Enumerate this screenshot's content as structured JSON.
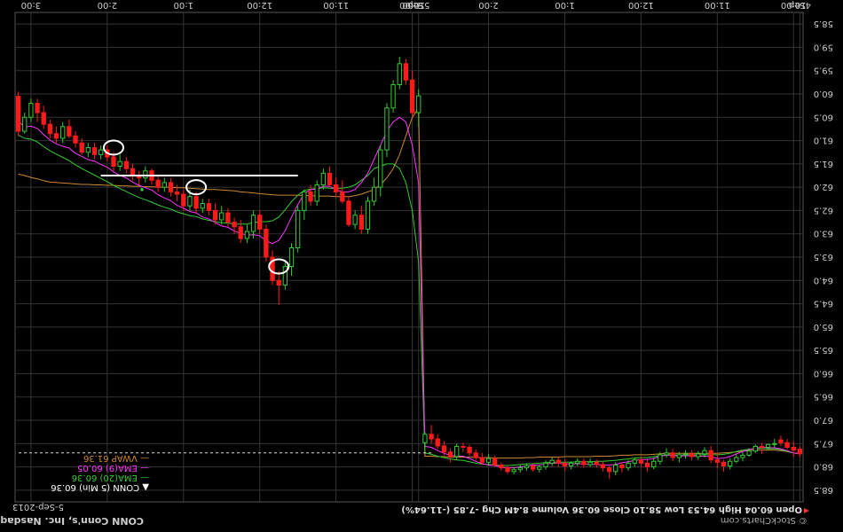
{
  "chart_data": {
    "type": "candlestick",
    "title": "CONN Conn's, Inc. Nasdaq GS",
    "date": "5-Sep-2013",
    "watermark": "© StockCharts.com",
    "summary": "Open 60.04  High 64.53  Low 58.10  Close 60.36  Volume 8.4M  Chg -7.85 (-11.64%)",
    "x_tick_labels": [
      "4Sep",
      "10:00",
      "11:00",
      "12:00",
      "1:00",
      "2:00",
      "3:00",
      "5Sep",
      "10:00",
      "11:00",
      "12:00",
      "1:00",
      "2:00",
      "3:00"
    ],
    "y_tick_labels": [
      "58.5",
      "59.0",
      "59.5",
      "60.0",
      "60.5",
      "61.0",
      "61.5",
      "62.0",
      "62.5",
      "63.0",
      "63.5",
      "64.0",
      "64.5",
      "65.0",
      "65.5",
      "66.0",
      "66.5",
      "67.0",
      "67.5",
      "68.0",
      "68.5"
    ],
    "ylim": [
      58.25,
      68.75
    ],
    "legend": [
      {
        "label": "CONN (5 Min) 60.36",
        "color": "#ffffff",
        "marker": "▲"
      },
      {
        "label": "EMA(20) 60.36",
        "color": "#33cc33"
      },
      {
        "label": "EMA(9) 60.05",
        "color": "#ff33ff"
      },
      {
        "label": "VWAP 61.36",
        "color": "#cc8833"
      }
    ],
    "colors": {
      "up": "#33cc33",
      "down": "#ff1a1a",
      "ema20": "#33cc33",
      "ema9": "#ff33ff",
      "vwap": "#cc8833",
      "grid": "#333333",
      "hline": "#ffffff",
      "circle": "#ffffff",
      "dash": "#dddddd"
    },
    "candles": [
      [
        67.72,
        67.62,
        67.8,
        67.55
      ],
      [
        67.64,
        67.58,
        67.78,
        67.45
      ],
      [
        67.58,
        67.48,
        67.62,
        67.4
      ],
      [
        67.48,
        67.42,
        67.55,
        67.33
      ],
      [
        67.5,
        67.52,
        67.58,
        67.4
      ],
      [
        67.52,
        67.58,
        67.65,
        67.5
      ],
      [
        67.58,
        67.56,
        67.72,
        67.48
      ],
      [
        67.56,
        67.66,
        67.7,
        67.52
      ],
      [
        67.66,
        67.75,
        67.78,
        67.6
      ],
      [
        67.75,
        67.8,
        67.88,
        67.68
      ],
      [
        67.8,
        67.88,
        67.92,
        67.72
      ],
      [
        67.88,
        67.98,
        68.05,
        67.82
      ],
      [
        67.98,
        67.9,
        68.1,
        67.85
      ],
      [
        67.9,
        67.85,
        68.02,
        67.7
      ],
      [
        67.85,
        67.65,
        67.92,
        67.55
      ],
      [
        67.65,
        67.72,
        67.8,
        67.58
      ],
      [
        67.72,
        67.78,
        67.85,
        67.66
      ],
      [
        67.78,
        67.72,
        67.86,
        67.64
      ],
      [
        67.72,
        67.74,
        67.82,
        67.64
      ],
      [
        67.74,
        67.8,
        67.9,
        67.68
      ],
      [
        67.8,
        67.7,
        67.88,
        67.62
      ],
      [
        67.7,
        67.74,
        67.8,
        67.6
      ],
      [
        67.74,
        67.88,
        67.95,
        67.68
      ],
      [
        67.88,
        68.0,
        68.05,
        67.8
      ],
      [
        68.0,
        67.92,
        68.1,
        67.85
      ],
      [
        67.92,
        67.85,
        68.0,
        67.78
      ],
      [
        67.85,
        67.92,
        68.0,
        67.8
      ],
      [
        67.92,
        68.02,
        68.08,
        67.86
      ],
      [
        68.02,
        67.96,
        68.12,
        67.9
      ],
      [
        67.96,
        68.1,
        68.18,
        67.9
      ],
      [
        68.1,
        68.02,
        68.25,
        67.98
      ],
      [
        68.02,
        67.95,
        68.1,
        67.88
      ],
      [
        67.95,
        67.9,
        68.02,
        67.84
      ],
      [
        67.9,
        67.95,
        68.0,
        67.82
      ],
      [
        67.95,
        67.88,
        68.02,
        67.82
      ],
      [
        67.88,
        67.92,
        67.98,
        67.82
      ],
      [
        67.92,
        67.98,
        68.05,
        67.88
      ],
      [
        67.98,
        67.92,
        68.08,
        67.84
      ],
      [
        67.92,
        67.86,
        68.0,
        67.8
      ],
      [
        67.86,
        67.92,
        67.98,
        67.8
      ],
      [
        67.92,
        68.0,
        68.06,
        67.86
      ],
      [
        68.0,
        68.05,
        68.12,
        67.95
      ],
      [
        68.05,
        67.98,
        68.1,
        67.92
      ],
      [
        67.98,
        68.02,
        68.08,
        67.92
      ],
      [
        68.02,
        68.06,
        68.12,
        67.96
      ],
      [
        68.06,
        68.1,
        68.16,
        68.0
      ],
      [
        68.1,
        68.02,
        68.15,
        67.96
      ],
      [
        68.02,
        67.96,
        68.08,
        67.9
      ],
      [
        67.96,
        67.82,
        68.0,
        67.76
      ],
      [
        67.82,
        67.9,
        67.96,
        67.72
      ],
      [
        67.9,
        67.8,
        67.95,
        67.7
      ],
      [
        67.8,
        67.7,
        67.86,
        67.62
      ],
      [
        67.7,
        67.58,
        67.76,
        67.52
      ],
      [
        67.58,
        67.56,
        67.68,
        67.48
      ],
      [
        67.56,
        67.78,
        67.85,
        67.5
      ],
      [
        67.78,
        67.68,
        67.9,
        67.6
      ],
      [
        67.68,
        67.55,
        67.75,
        67.45
      ],
      [
        67.55,
        67.4,
        67.62,
        67.3
      ],
      [
        67.4,
        67.3,
        67.5,
        67.1
      ],
      [
        67.3,
        67.48,
        67.58,
        67.25
      ],
      [
        60.04,
        60.4,
        60.7,
        59.9
      ],
      [
        60.4,
        59.7,
        60.5,
        59.5
      ],
      [
        59.7,
        59.35,
        59.8,
        59.25
      ],
      [
        59.35,
        59.8,
        59.9,
        59.2
      ],
      [
        59.8,
        60.3,
        60.4,
        59.7
      ],
      [
        60.3,
        61.2,
        61.35,
        60.2
      ],
      [
        61.2,
        62.0,
        62.2,
        61.1
      ],
      [
        62.0,
        62.3,
        62.4,
        61.8
      ],
      [
        62.3,
        62.9,
        63.0,
        62.2
      ],
      [
        62.9,
        62.6,
        63.0,
        62.4
      ],
      [
        62.6,
        62.8,
        62.9,
        62.5
      ],
      [
        62.8,
        62.3,
        62.85,
        62.2
      ],
      [
        62.3,
        62.1,
        62.35,
        61.85
      ],
      [
        62.1,
        61.95,
        62.2,
        61.8
      ],
      [
        61.95,
        61.7,
        62.0,
        61.55
      ],
      [
        61.7,
        61.95,
        62.05,
        61.6
      ],
      [
        61.95,
        62.3,
        62.4,
        61.85
      ],
      [
        62.3,
        62.1,
        62.4,
        61.95
      ],
      [
        62.1,
        62.5,
        62.7,
        62.05
      ],
      [
        62.5,
        63.3,
        63.4,
        62.4
      ],
      [
        63.3,
        63.7,
        63.9,
        63.2
      ],
      [
        63.7,
        64.1,
        64.2,
        63.6
      ],
      [
        64.1,
        64.0,
        64.53,
        63.8
      ],
      [
        64.0,
        63.5,
        64.1,
        63.35
      ],
      [
        63.5,
        62.9,
        63.6,
        62.8
      ],
      [
        62.9,
        62.6,
        63.0,
        62.5
      ],
      [
        62.6,
        62.95,
        63.1,
        62.5
      ],
      [
        62.95,
        63.1,
        63.2,
        62.8
      ],
      [
        63.1,
        62.85,
        63.2,
        62.7
      ],
      [
        62.85,
        62.75,
        63.0,
        62.65
      ],
      [
        62.75,
        62.55,
        62.85,
        62.45
      ],
      [
        62.55,
        62.7,
        62.8,
        62.4
      ],
      [
        62.7,
        62.5,
        62.8,
        62.35
      ],
      [
        62.5,
        62.35,
        62.6,
        62.25
      ],
      [
        62.35,
        62.45,
        62.55,
        62.25
      ],
      [
        62.45,
        62.2,
        62.55,
        62.1
      ],
      [
        62.2,
        62.4,
        62.5,
        62.05
      ],
      [
        62.4,
        62.15,
        62.5,
        62.05
      ],
      [
        62.15,
        62.1,
        62.3,
        61.95
      ],
      [
        62.1,
        61.9,
        62.2,
        61.8
      ],
      [
        61.9,
        62.0,
        62.1,
        61.8
      ],
      [
        62.0,
        61.85,
        62.1,
        61.75
      ],
      [
        61.85,
        61.65,
        61.95,
        61.6
      ],
      [
        61.65,
        61.8,
        61.9,
        61.55
      ],
      [
        61.8,
        61.75,
        61.95,
        61.65
      ],
      [
        61.75,
        61.6,
        61.85,
        61.5
      ],
      [
        61.6,
        61.45,
        61.7,
        61.35
      ],
      [
        61.45,
        61.55,
        61.65,
        61.3
      ],
      [
        61.55,
        61.35,
        61.65,
        61.25
      ],
      [
        61.35,
        61.2,
        61.45,
        61.1
      ],
      [
        61.2,
        61.3,
        61.4,
        61.1
      ],
      [
        61.3,
        61.15,
        61.4,
        61.05
      ],
      [
        61.15,
        61.25,
        61.35,
        61.05
      ],
      [
        61.25,
        61.05,
        61.3,
        60.95
      ],
      [
        61.05,
        60.9,
        61.15,
        60.8
      ],
      [
        60.9,
        60.7,
        60.95,
        60.55
      ],
      [
        60.7,
        60.95,
        61.05,
        60.6
      ],
      [
        60.95,
        60.85,
        61.05,
        60.7
      ],
      [
        60.85,
        60.65,
        60.95,
        60.55
      ],
      [
        60.65,
        60.4,
        60.75,
        60.25
      ],
      [
        60.4,
        60.2,
        60.6,
        60.1
      ],
      [
        60.2,
        60.5,
        60.6,
        60.1
      ],
      [
        60.5,
        60.8,
        60.85,
        60.4
      ],
      [
        60.8,
        60.05,
        60.9,
        59.95
      ]
    ],
    "ema20": [
      67.72,
      67.7,
      67.67,
      67.63,
      67.61,
      67.61,
      67.6,
      67.61,
      67.62,
      67.64,
      67.67,
      67.71,
      67.73,
      67.74,
      67.74,
      67.74,
      67.74,
      67.74,
      67.74,
      67.75,
      67.74,
      67.74,
      67.76,
      67.78,
      67.8,
      67.8,
      67.81,
      67.83,
      67.84,
      67.86,
      67.87,
      67.88,
      67.88,
      67.89,
      67.89,
      67.89,
      67.9,
      67.9,
      67.9,
      67.9,
      67.91,
      67.92,
      67.93,
      67.94,
      67.95,
      67.96,
      67.97,
      67.97,
      67.96,
      67.95,
      67.94,
      67.92,
      67.89,
      67.86,
      67.85,
      67.83,
      67.8,
      67.77,
      67.73,
      67.7,
      63.6,
      62.5,
      61.9,
      61.6,
      61.5,
      61.5,
      61.55,
      61.6,
      61.75,
      61.85,
      61.95,
      62.0,
      62.02,
      62.03,
      62.02,
      62.01,
      62.03,
      62.04,
      62.07,
      62.17,
      62.31,
      62.48,
      62.64,
      62.72,
      62.74,
      62.74,
      62.76,
      62.79,
      62.79,
      62.79,
      62.77,
      62.76,
      62.74,
      62.71,
      62.68,
      62.63,
      62.61,
      62.57,
      62.53,
      62.47,
      62.43,
      62.38,
      62.32,
      62.27,
      62.22,
      62.16,
      62.09,
      62.03,
      61.96,
      61.88,
      61.81,
      61.74,
      61.67,
      61.6,
      61.52,
      61.43,
      61.36,
      61.29,
      61.22,
      61.13,
      61.03,
      60.97,
      60.95,
      60.88
    ],
    "ema9": [
      67.72,
      67.7,
      67.65,
      67.61,
      67.59,
      67.59,
      67.58,
      67.6,
      67.63,
      67.67,
      67.72,
      67.78,
      67.81,
      67.82,
      67.78,
      67.77,
      67.77,
      67.76,
      67.76,
      67.77,
      67.75,
      67.75,
      67.77,
      67.82,
      67.84,
      67.84,
      67.86,
      67.89,
      67.91,
      67.95,
      67.96,
      67.96,
      67.95,
      67.95,
      67.94,
      67.93,
      67.94,
      67.94,
      67.92,
      67.92,
      67.94,
      67.96,
      67.96,
      67.98,
      68.0,
      68.02,
      68.02,
      68.01,
      67.97,
      67.96,
      67.93,
      67.88,
      67.82,
      67.77,
      67.77,
      67.75,
      67.71,
      67.65,
      67.58,
      67.56,
      61.9,
      61.1,
      60.6,
      60.5,
      60.6,
      60.8,
      61.1,
      61.4,
      61.7,
      61.9,
      62.05,
      62.1,
      62.1,
      62.05,
      61.98,
      61.98,
      62.04,
      62.05,
      62.14,
      62.37,
      62.64,
      62.93,
      63.14,
      63.21,
      63.15,
      63.04,
      63.02,
      63.03,
      62.99,
      62.94,
      62.86,
      62.83,
      62.76,
      62.68,
      62.64,
      62.55,
      62.52,
      62.45,
      62.39,
      62.29,
      62.23,
      62.16,
      62.06,
      62.01,
      61.96,
      61.89,
      61.8,
      61.75,
      61.67,
      61.57,
      61.51,
      61.44,
      61.41,
      61.34,
      61.27,
      61.16,
      61.12,
      61.07,
      60.99,
      60.87,
      60.74,
      60.69,
      60.71,
      60.58
    ],
    "vwap": [
      67.72,
      67.7,
      67.67,
      67.65,
      67.64,
      67.64,
      67.64,
      67.64,
      67.65,
      67.66,
      67.68,
      67.69,
      67.7,
      67.71,
      67.71,
      67.71,
      67.71,
      67.71,
      67.71,
      67.71,
      67.71,
      67.71,
      67.72,
      67.73,
      67.74,
      67.74,
      67.74,
      67.75,
      67.75,
      67.76,
      67.77,
      67.77,
      67.77,
      67.78,
      67.78,
      67.78,
      67.78,
      67.78,
      67.79,
      67.79,
      67.79,
      67.79,
      67.8,
      67.8,
      67.81,
      67.81,
      67.81,
      67.81,
      67.81,
      67.8,
      67.8,
      67.8,
      67.79,
      67.79,
      67.79,
      67.79,
      67.78,
      67.78,
      67.77,
      67.77,
      60.3,
      60.5,
      60.9,
      61.3,
      61.6,
      61.8,
      61.95,
      62.05,
      62.1,
      62.15,
      62.18,
      62.2,
      62.2,
      62.2,
      62.19,
      62.19,
      62.19,
      62.18,
      62.18,
      62.17,
      62.17,
      62.17,
      62.17,
      62.16,
      62.15,
      62.14,
      62.12,
      62.11,
      62.1,
      62.08,
      62.07,
      62.06,
      62.05,
      62.05,
      62.04,
      62.03,
      62.02,
      62.01,
      62.01,
      62.0,
      62.0,
      62.0,
      61.99,
      61.99,
      61.98,
      61.98,
      61.97,
      61.97,
      61.96,
      61.96,
      61.95,
      61.95,
      61.94,
      61.94,
      61.93,
      61.92,
      61.91,
      61.9,
      61.89,
      61.86,
      61.82,
      61.79,
      61.75,
      61.72
    ],
    "hline_value": 61.75,
    "dashed_value": 67.7,
    "green_dot_value": 62.05,
    "circled_candles": [
      82,
      95,
      108
    ]
  }
}
